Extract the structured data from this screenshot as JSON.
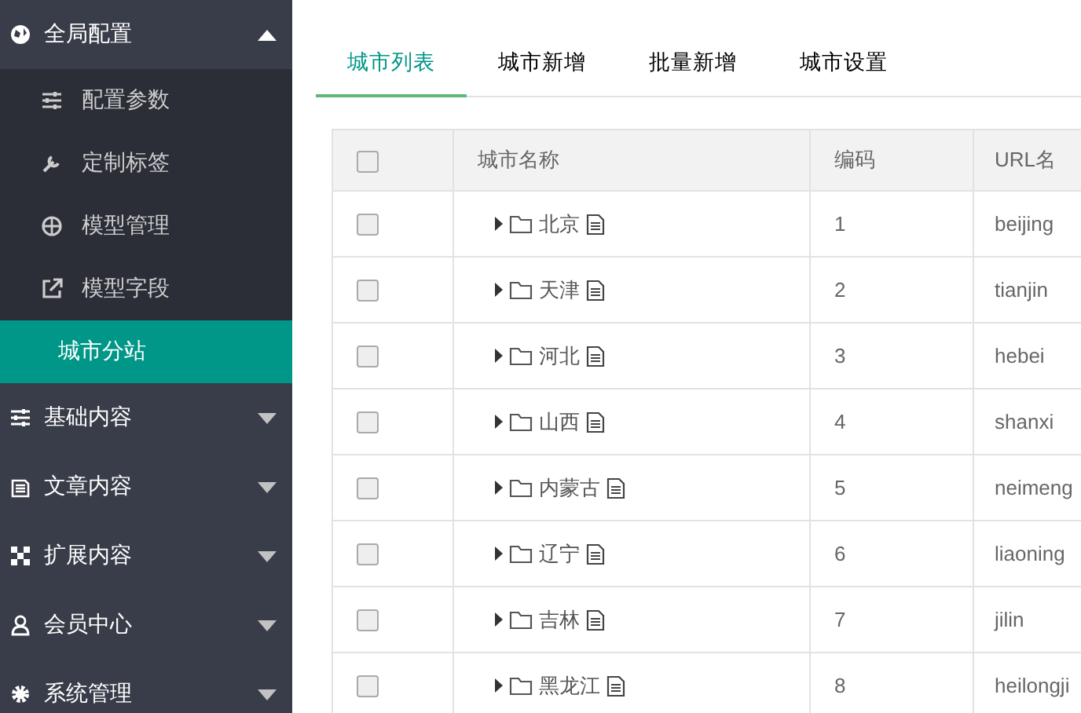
{
  "sidebar": {
    "groups": [
      {
        "label": "全局配置",
        "expanded": true,
        "children": [
          {
            "label": "配置参数",
            "selected": false
          },
          {
            "label": "定制标签",
            "selected": false
          },
          {
            "label": "模型管理",
            "selected": false
          },
          {
            "label": "模型字段",
            "selected": false
          },
          {
            "label": "城市分站",
            "selected": true
          }
        ]
      },
      {
        "label": "基础内容",
        "expanded": false
      },
      {
        "label": "文章内容",
        "expanded": false
      },
      {
        "label": "扩展内容",
        "expanded": false
      },
      {
        "label": "会员中心",
        "expanded": false
      },
      {
        "label": "系统管理",
        "expanded": false
      }
    ]
  },
  "tabs": [
    {
      "label": "城市列表",
      "selected": true
    },
    {
      "label": "城市新增",
      "selected": false
    },
    {
      "label": "批量新增",
      "selected": false
    },
    {
      "label": "城市设置",
      "selected": false
    }
  ],
  "table": {
    "header_checked": false,
    "columns": [
      "城市名称",
      "编码",
      "URL名"
    ],
    "rows": [
      {
        "checked": false,
        "expanded": false,
        "name": "北京",
        "code": "1",
        "url": "beijing"
      },
      {
        "checked": false,
        "expanded": false,
        "name": "天津",
        "code": "2",
        "url": "tianjin"
      },
      {
        "checked": false,
        "expanded": false,
        "name": "河北",
        "code": "3",
        "url": "hebei"
      },
      {
        "checked": false,
        "expanded": false,
        "name": "山西",
        "code": "4",
        "url": "shanxi"
      },
      {
        "checked": false,
        "expanded": false,
        "name": "内蒙古",
        "code": "5",
        "url": "neimeng"
      },
      {
        "checked": false,
        "expanded": false,
        "name": "辽宁",
        "code": "6",
        "url": "liaoning"
      },
      {
        "checked": false,
        "expanded": false,
        "name": "吉林",
        "code": "7",
        "url": "jilin"
      },
      {
        "checked": false,
        "expanded": false,
        "name": "黑龙江",
        "code": "8",
        "url": "heilongji"
      }
    ]
  }
}
